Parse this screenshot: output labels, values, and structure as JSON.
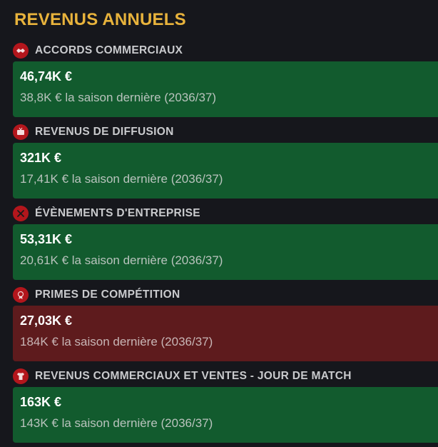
{
  "header": {
    "title": "REVENUS ANNUELS"
  },
  "colors": {
    "title": "#e8b33c",
    "positive": "#125b2e",
    "negative": "#5e1b1d",
    "icon": "#b3161c"
  },
  "sections": [
    {
      "icon": "handshake-icon",
      "label": "ACCORDS COMMERCIAUX",
      "value": "46,74K €",
      "previous": "38,8K € la saison dernière (2036/37)",
      "trend": "up"
    },
    {
      "icon": "broadcast-icon",
      "label": "REVENUS DE DIFFUSION",
      "value": "321K €",
      "previous": "17,41K € la saison dernière (2036/37)",
      "trend": "up"
    },
    {
      "icon": "cutlery-icon",
      "label": "ÉVÈNEMENTS D'ENTREPRISE",
      "value": "53,31K €",
      "previous": "20,61K € la saison dernière (2036/37)",
      "trend": "up"
    },
    {
      "icon": "medal-icon",
      "label": "PRIMES DE COMPÉTITION",
      "value": "27,03K €",
      "previous": "184K € la saison dernière (2036/37)",
      "trend": "down"
    },
    {
      "icon": "shirt-icon",
      "label": "REVENUS COMMERCIAUX ET VENTES - JOUR DE MATCH",
      "value": "163K €",
      "previous": "143K € la saison dernière (2036/37)",
      "trend": "up"
    }
  ]
}
